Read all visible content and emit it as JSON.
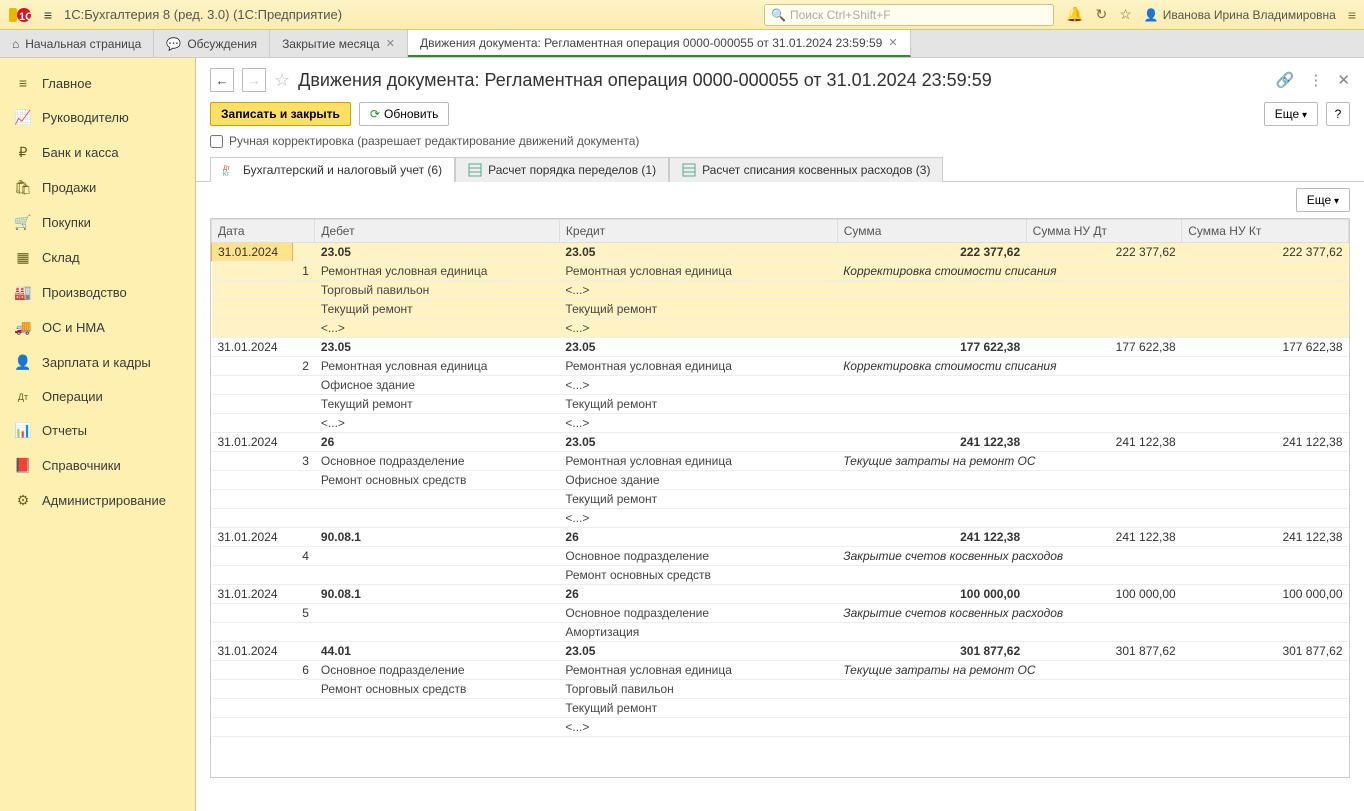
{
  "app": {
    "title": "1С:Бухгалтерия 8 (ред. 3.0)  (1С:Предприятие)",
    "search_placeholder": "Поиск Ctrl+Shift+F",
    "user_name": "Иванова Ирина Владимировна"
  },
  "tabs": [
    {
      "icon": "home-icon",
      "label": "Начальная страница",
      "closable": false
    },
    {
      "icon": "discussions-icon",
      "label": "Обсуждения",
      "closable": false
    },
    {
      "icon": "",
      "label": "Закрытие месяца",
      "closable": true
    },
    {
      "icon": "",
      "label": "Движения документа: Регламентная операция 0000-000055 от 31.01.2024 23:59:59",
      "closable": true,
      "active": true
    }
  ],
  "sidebar": {
    "items": [
      {
        "icon": "≡",
        "label": "Главное"
      },
      {
        "icon": "📈",
        "label": "Руководителю"
      },
      {
        "icon": "₽",
        "label": "Банк и касса"
      },
      {
        "icon": "🛍",
        "label": "Продажи"
      },
      {
        "icon": "🛒",
        "label": "Покупки"
      },
      {
        "icon": "▦",
        "label": "Склад"
      },
      {
        "icon": "🏭",
        "label": "Производство"
      },
      {
        "icon": "🚚",
        "label": "ОС и НМА"
      },
      {
        "icon": "👤",
        "label": "Зарплата и кадры"
      },
      {
        "icon": "Дт",
        "label": "Операции"
      },
      {
        "icon": "📊",
        "label": "Отчеты"
      },
      {
        "icon": "📕",
        "label": "Справочники"
      },
      {
        "icon": "⚙",
        "label": "Администрирование"
      }
    ]
  },
  "doc": {
    "title": "Движения документа: Регламентная операция 0000-000055 от 31.01.2024 23:59:59",
    "save_close": "Записать и закрыть",
    "refresh": "Обновить",
    "more": "Еще",
    "help": "?",
    "manual_label": "Ручная корректировка (разрешает редактирование движений документа)"
  },
  "innertabs": [
    {
      "label": "Бухгалтерский и налоговый учет (6)",
      "active": true
    },
    {
      "label": "Расчет порядка переделов (1)"
    },
    {
      "label": "Расчет списания косвенных расходов (3)"
    }
  ],
  "grid_more": "Еще",
  "grid": {
    "headers": {
      "date": "Дата",
      "debit": "Дебет",
      "credit": "Кредит",
      "sum": "Сумма",
      "sum_nu_dt": "Сумма НУ Дт",
      "sum_nu_kt": "Сумма НУ Кт"
    },
    "entries": [
      {
        "highlight": true,
        "date": "31.01.2024",
        "num": "1",
        "debit_acc": "23.05",
        "credit_acc": "23.05",
        "sum": "222 377,62",
        "sum_nu_dt": "222 377,62",
        "sum_nu_kt": "222 377,62",
        "desc": "Корректировка стоимости списания",
        "debit_lines": [
          "Ремонтная условная единица",
          "Торговый павильон",
          "Текущий ремонт",
          "<...>"
        ],
        "credit_lines": [
          "Ремонтная условная единица",
          "<...>",
          "Текущий ремонт",
          "<...>"
        ]
      },
      {
        "date": "31.01.2024",
        "num": "2",
        "debit_acc": "23.05",
        "credit_acc": "23.05",
        "sum": "177 622,38",
        "sum_nu_dt": "177 622,38",
        "sum_nu_kt": "177 622,38",
        "desc": "Корректировка стоимости списания",
        "debit_lines": [
          "Ремонтная условная единица",
          "Офисное здание",
          "Текущий ремонт",
          "<...>"
        ],
        "credit_lines": [
          "Ремонтная условная единица",
          "<...>",
          "Текущий ремонт",
          "<...>"
        ]
      },
      {
        "date": "31.01.2024",
        "num": "3",
        "debit_acc": "26",
        "credit_acc": "23.05",
        "sum": "241 122,38",
        "sum_nu_dt": "241 122,38",
        "sum_nu_kt": "241 122,38",
        "desc": "Текущие затраты на ремонт ОС",
        "debit_lines": [
          "Основное подразделение",
          "Ремонт основных средств",
          "",
          ""
        ],
        "credit_lines": [
          "Ремонтная условная единица",
          "Офисное здание",
          "Текущий ремонт",
          "<...>"
        ]
      },
      {
        "date": "31.01.2024",
        "num": "4",
        "debit_acc": "90.08.1",
        "credit_acc": "26",
        "sum": "241 122,38",
        "sum_nu_dt": "241 122,38",
        "sum_nu_kt": "241 122,38",
        "desc": "Закрытие счетов косвенных расходов",
        "debit_lines": [
          "",
          "",
          "",
          ""
        ],
        "credit_lines": [
          "Основное подразделение",
          "Ремонт основных средств",
          "",
          ""
        ]
      },
      {
        "date": "31.01.2024",
        "num": "5",
        "debit_acc": "90.08.1",
        "credit_acc": "26",
        "sum": "100 000,00",
        "sum_nu_dt": "100 000,00",
        "sum_nu_kt": "100 000,00",
        "desc": "Закрытие счетов косвенных расходов",
        "debit_lines": [
          "",
          "",
          "",
          ""
        ],
        "credit_lines": [
          "Основное подразделение",
          "Амортизация",
          "",
          ""
        ]
      },
      {
        "date": "31.01.2024",
        "num": "6",
        "debit_acc": "44.01",
        "credit_acc": "23.05",
        "sum": "301 877,62",
        "sum_nu_dt": "301 877,62",
        "sum_nu_kt": "301 877,62",
        "desc": "Текущие затраты на ремонт ОС",
        "debit_lines": [
          "Основное подразделение",
          "Ремонт основных средств",
          "",
          ""
        ],
        "credit_lines": [
          "Ремонтная условная единица",
          "Торговый павильон",
          "Текущий ремонт",
          "<...>"
        ]
      }
    ]
  }
}
